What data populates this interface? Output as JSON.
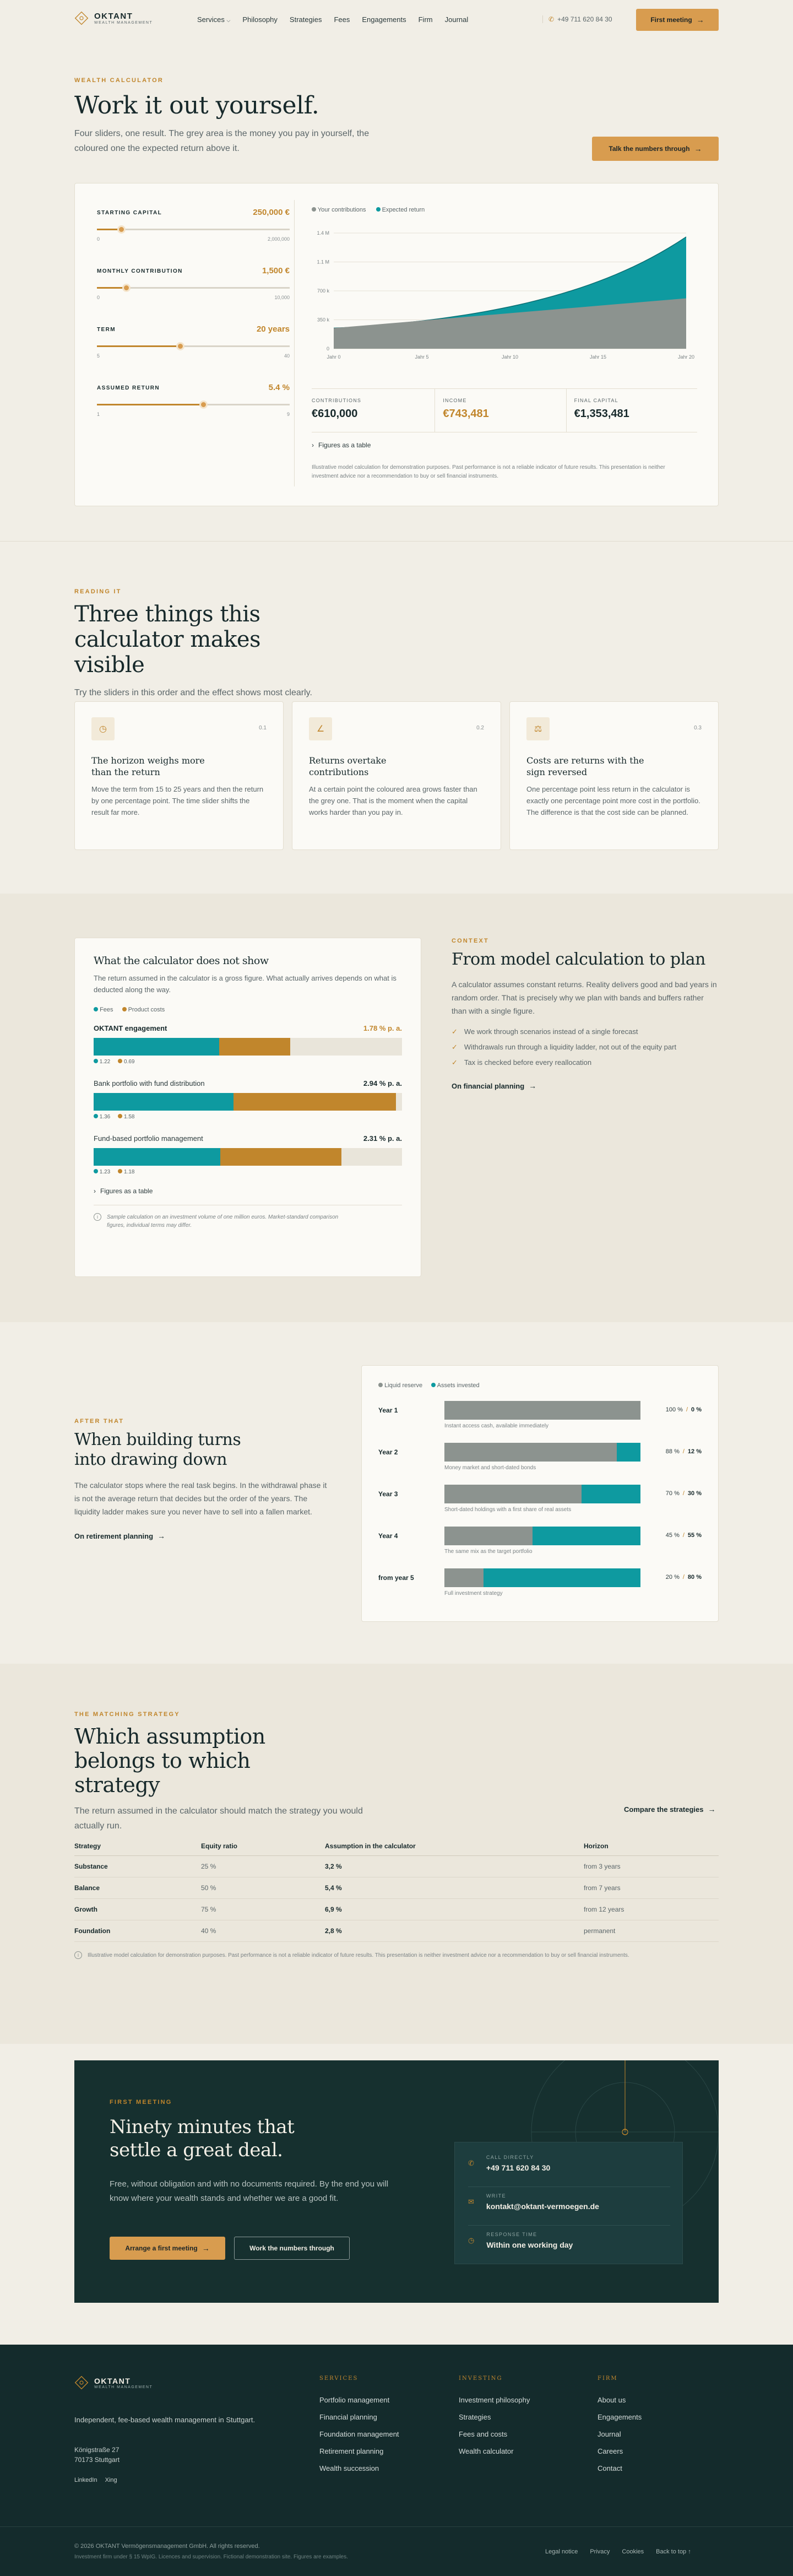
{
  "nav": {
    "brand": "OKTANT",
    "brand_sub": "WEALTH MANAGEMENT",
    "items": [
      "Services",
      "Philosophy",
      "Strategies",
      "Fees",
      "Engagements",
      "Firm",
      "Journal"
    ],
    "phone": "+49 711 620 84 30",
    "cta": "First meeting"
  },
  "hero": {
    "eyebrow": "WEALTH CALCULATOR",
    "title": "Work it out yourself.",
    "lead": "Four sliders, one result. The grey area is the money you pay in yourself, the coloured one the expected return above it.",
    "cta": "Talk the numbers through"
  },
  "calc": {
    "sliders": [
      {
        "label": "STARTING CAPITAL",
        "value": "250,000 €",
        "min": "0",
        "max": "2,000,000",
        "fraction": 0.125
      },
      {
        "label": "MONTHLY CONTRIBUTION",
        "value": "1,500 €",
        "min": "0",
        "max": "10,000",
        "fraction": 0.15
      },
      {
        "label": "TERM",
        "value": "20 years",
        "min": "5",
        "max": "40",
        "fraction": 0.43
      },
      {
        "label": "ASSUMED RETURN",
        "value": "5.4 %",
        "min": "1",
        "max": "9",
        "fraction": 0.55
      }
    ],
    "legend": {
      "contrib": "Your contributions",
      "ret": "Expected return"
    },
    "y_ticks": [
      "1.4 M",
      "1.1 M",
      "700 k",
      "350 k",
      "0"
    ],
    "x_ticks": [
      "Jahr 0",
      "Jahr 5",
      "Jahr 10",
      "Jahr 15",
      "Jahr 20"
    ],
    "stats": [
      {
        "label": "CONTRIBUTIONS",
        "value": "€610,000"
      },
      {
        "label": "INCOME",
        "value": "€743,481"
      },
      {
        "label": "FINAL CAPITAL",
        "value": "€1,353,481"
      }
    ],
    "table_toggle": "Figures as a table",
    "disclaimer": "Illustrative model calculation for demonstration purposes. Past performance is not a reliable indicator of future results. This presentation is neither investment advice nor a recommendation to buy or sell financial instruments."
  },
  "chart_data": {
    "type": "area",
    "x": [
      0,
      5,
      10,
      15,
      20
    ],
    "series": [
      {
        "name": "Your contributions",
        "values": [
          250000,
          340000,
          430000,
          520000,
          610000
        ]
      },
      {
        "name": "Expected return",
        "values": [
          250000,
          430000,
          660000,
          960000,
          1353481
        ]
      }
    ],
    "ylim": [
      0,
      1400000
    ]
  },
  "reading": {
    "eyebrow": "READING IT",
    "title": "Three things this calculator makes visible",
    "lead": "Try the sliders in this order and the effect shows most clearly.",
    "cards": [
      {
        "num": "0.1",
        "title": "The horizon weighs more than the return",
        "text": "Move the term from 15 to 25 years and then the return by one percentage point. The time slider shifts the result far more."
      },
      {
        "num": "0.2",
        "title": "Returns overtake contributions",
        "text": "At a certain point the coloured area grows faster than the grey one. That is the moment when the capital works harder than you pay in."
      },
      {
        "num": "0.3",
        "title": "Costs are returns with the sign reversed",
        "text": "One percentage point less return in the calculator is exactly one percentage point more cost in the portfolio. The difference is that the cost side can be planned."
      }
    ]
  },
  "costs": {
    "title": "What the calculator does not show",
    "text": "The return assumed in the calculator is a gross figure. What actually arrives depends on what is deducted along the way.",
    "legend": {
      "fees": "Fees",
      "product": "Product costs"
    },
    "rows": [
      {
        "name": "OKTANT engagement",
        "total": "1.78 % p. a.",
        "fees": "1.22",
        "product": "0.69",
        "fee_pct": 1.22,
        "prod_pct": 0.69
      },
      {
        "name": "Bank portfolio with fund distribution",
        "total": "2.94 % p. a.",
        "fees": "1.36",
        "product": "1.58",
        "fee_pct": 1.36,
        "prod_pct": 1.58
      },
      {
        "name": "Fund-based portfolio management",
        "total": "2.31 % p. a.",
        "fees": "1.23",
        "product": "1.18",
        "fee_pct": 1.23,
        "prod_pct": 1.18
      }
    ],
    "toggle": "Figures as a table",
    "note": "Sample calculation on an investment volume of one million euros. Market-standard comparison figures, individual terms may differ."
  },
  "context": {
    "eyebrow": "CONTEXT",
    "title": "From model calculation to plan",
    "text": "A calculator assumes constant returns. Reality delivers good and bad years in random order. That is precisely why we plan with bands and buffers rather than with a single figure.",
    "checks": [
      "We work through scenarios instead of a single forecast",
      "Withdrawals run through a liquidity ladder, not out of the equity part",
      "Tax is checked before every reallocation"
    ],
    "link": "On financial planning"
  },
  "after": {
    "eyebrow": "AFTER THAT",
    "title": "When building turns into drawing down",
    "text": "The calculator stops where the real task begins. In the withdrawal phase it is not the average return that decides but the order of the years. The liquidity ladder makes sure you never have to sell into a fallen market.",
    "link": "On retirement planning"
  },
  "ladder": {
    "legend": {
      "liquid": "Liquid reserve",
      "invested": "Assets invested"
    },
    "rows": [
      {
        "label": "Year 1",
        "pct": "100 %",
        "inv": "0 %",
        "liquid": 1.0,
        "note": "Instant access cash, available immediately"
      },
      {
        "label": "Year 2",
        "pct": "88 %",
        "inv": "12 %",
        "liquid": 0.88,
        "note": "Money market and short-dated bonds"
      },
      {
        "label": "Year 3",
        "pct": "70 %",
        "inv": "30 %",
        "liquid": 0.7,
        "note": "Short-dated holdings with a first share of real assets"
      },
      {
        "label": "Year 4",
        "pct": "45 %",
        "inv": "55 %",
        "liquid": 0.45,
        "note": "The same mix as the target portfolio"
      },
      {
        "label": "from year 5",
        "pct": "20 %",
        "inv": "80 %",
        "liquid": 0.2,
        "note": "Full investment strategy"
      }
    ]
  },
  "strategy": {
    "eyebrow": "THE MATCHING STRATEGY",
    "title": "Which assumption belongs to which strategy",
    "lead": "The return assumed in the calculator should match the strategy you would actually run.",
    "link": "Compare the strategies",
    "headers": [
      "Strategy",
      "Equity ratio",
      "Assumption in the calculator",
      "Horizon"
    ],
    "rows": [
      [
        "Substance",
        "25 %",
        "3,2 %",
        "from 3 years"
      ],
      [
        "Balance",
        "50 %",
        "5,4 %",
        "from 7 years"
      ],
      [
        "Growth",
        "75 %",
        "6,9 %",
        "from 12 years"
      ],
      [
        "Foundation",
        "40 %",
        "2,8 %",
        "permanent"
      ]
    ],
    "disclaimer": "Illustrative model calculation for demonstration purposes. Past performance is not a reliable indicator of future results. This presentation is neither investment advice nor a recommendation to buy or sell financial instruments."
  },
  "meeting": {
    "eyebrow": "FIRST MEETING",
    "title": "Ninety minutes that settle a great deal.",
    "text": "Free, without obligation and with no documents required. By the end you will know where your wealth stands and whether we are a good fit.",
    "cta1": "Arrange a first meeting",
    "cta2": "Work the numbers through",
    "contacts": [
      {
        "label": "CALL DIRECTLY",
        "value": "+49 711 620 84 30"
      },
      {
        "label": "WRITE",
        "value": "kontakt@oktant-vermoegen.de"
      },
      {
        "label": "RESPONSE TIME",
        "value": "Within one working day"
      }
    ]
  },
  "footer": {
    "tagline": "Independent, fee-based wealth management in Stuttgart.",
    "address1": "Königstraße 27",
    "address2": "70173 Stuttgart",
    "social": [
      "LinkedIn",
      "Xing"
    ],
    "cols": [
      {
        "title": "SERVICES",
        "items": [
          "Portfolio management",
          "Financial planning",
          "Foundation management",
          "Retirement planning",
          "Wealth succession"
        ]
      },
      {
        "title": "INVESTING",
        "items": [
          "Investment philosophy",
          "Strategies",
          "Fees and costs",
          "Wealth calculator"
        ]
      },
      {
        "title": "FIRM",
        "items": [
          "About us",
          "Engagements",
          "Journal",
          "Careers",
          "Contact"
        ]
      }
    ],
    "copyright": "© 2026 OKTANT Vermögensmanagement GmbH. All rights reserved.",
    "fineprint": "Investment firm under § 15 WpIG. Licences and supervision. Fictional demonstration site. Figures are examples.",
    "legal": [
      "Legal notice",
      "Privacy",
      "Cookies",
      "Back to top"
    ]
  },
  "colors": {
    "teal": "#0e9aa0",
    "gold": "#c1862c",
    "grey": "#8c938f",
    "dark": "#17292b"
  }
}
